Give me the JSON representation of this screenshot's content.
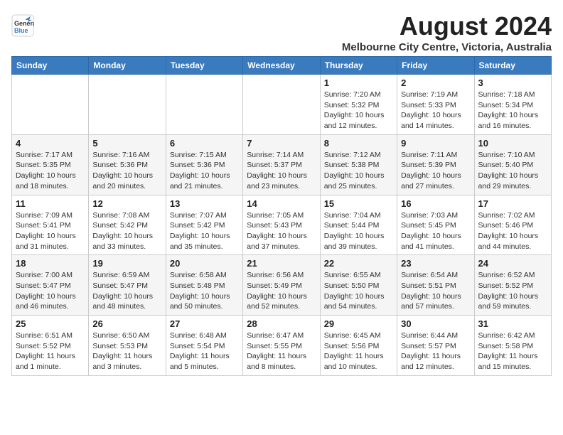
{
  "logo": {
    "general": "General",
    "blue": "Blue"
  },
  "title": "August 2024",
  "subtitle": "Melbourne City Centre, Victoria, Australia",
  "days_of_week": [
    "Sunday",
    "Monday",
    "Tuesday",
    "Wednesday",
    "Thursday",
    "Friday",
    "Saturday"
  ],
  "weeks": [
    [
      {
        "day": "",
        "info": ""
      },
      {
        "day": "",
        "info": ""
      },
      {
        "day": "",
        "info": ""
      },
      {
        "day": "",
        "info": ""
      },
      {
        "day": "1",
        "info": "Sunrise: 7:20 AM\nSunset: 5:32 PM\nDaylight: 10 hours\nand 12 minutes."
      },
      {
        "day": "2",
        "info": "Sunrise: 7:19 AM\nSunset: 5:33 PM\nDaylight: 10 hours\nand 14 minutes."
      },
      {
        "day": "3",
        "info": "Sunrise: 7:18 AM\nSunset: 5:34 PM\nDaylight: 10 hours\nand 16 minutes."
      }
    ],
    [
      {
        "day": "4",
        "info": "Sunrise: 7:17 AM\nSunset: 5:35 PM\nDaylight: 10 hours\nand 18 minutes."
      },
      {
        "day": "5",
        "info": "Sunrise: 7:16 AM\nSunset: 5:36 PM\nDaylight: 10 hours\nand 20 minutes."
      },
      {
        "day": "6",
        "info": "Sunrise: 7:15 AM\nSunset: 5:36 PM\nDaylight: 10 hours\nand 21 minutes."
      },
      {
        "day": "7",
        "info": "Sunrise: 7:14 AM\nSunset: 5:37 PM\nDaylight: 10 hours\nand 23 minutes."
      },
      {
        "day": "8",
        "info": "Sunrise: 7:12 AM\nSunset: 5:38 PM\nDaylight: 10 hours\nand 25 minutes."
      },
      {
        "day": "9",
        "info": "Sunrise: 7:11 AM\nSunset: 5:39 PM\nDaylight: 10 hours\nand 27 minutes."
      },
      {
        "day": "10",
        "info": "Sunrise: 7:10 AM\nSunset: 5:40 PM\nDaylight: 10 hours\nand 29 minutes."
      }
    ],
    [
      {
        "day": "11",
        "info": "Sunrise: 7:09 AM\nSunset: 5:41 PM\nDaylight: 10 hours\nand 31 minutes."
      },
      {
        "day": "12",
        "info": "Sunrise: 7:08 AM\nSunset: 5:42 PM\nDaylight: 10 hours\nand 33 minutes."
      },
      {
        "day": "13",
        "info": "Sunrise: 7:07 AM\nSunset: 5:42 PM\nDaylight: 10 hours\nand 35 minutes."
      },
      {
        "day": "14",
        "info": "Sunrise: 7:05 AM\nSunset: 5:43 PM\nDaylight: 10 hours\nand 37 minutes."
      },
      {
        "day": "15",
        "info": "Sunrise: 7:04 AM\nSunset: 5:44 PM\nDaylight: 10 hours\nand 39 minutes."
      },
      {
        "day": "16",
        "info": "Sunrise: 7:03 AM\nSunset: 5:45 PM\nDaylight: 10 hours\nand 41 minutes."
      },
      {
        "day": "17",
        "info": "Sunrise: 7:02 AM\nSunset: 5:46 PM\nDaylight: 10 hours\nand 44 minutes."
      }
    ],
    [
      {
        "day": "18",
        "info": "Sunrise: 7:00 AM\nSunset: 5:47 PM\nDaylight: 10 hours\nand 46 minutes."
      },
      {
        "day": "19",
        "info": "Sunrise: 6:59 AM\nSunset: 5:47 PM\nDaylight: 10 hours\nand 48 minutes."
      },
      {
        "day": "20",
        "info": "Sunrise: 6:58 AM\nSunset: 5:48 PM\nDaylight: 10 hours\nand 50 minutes."
      },
      {
        "day": "21",
        "info": "Sunrise: 6:56 AM\nSunset: 5:49 PM\nDaylight: 10 hours\nand 52 minutes."
      },
      {
        "day": "22",
        "info": "Sunrise: 6:55 AM\nSunset: 5:50 PM\nDaylight: 10 hours\nand 54 minutes."
      },
      {
        "day": "23",
        "info": "Sunrise: 6:54 AM\nSunset: 5:51 PM\nDaylight: 10 hours\nand 57 minutes."
      },
      {
        "day": "24",
        "info": "Sunrise: 6:52 AM\nSunset: 5:52 PM\nDaylight: 10 hours\nand 59 minutes."
      }
    ],
    [
      {
        "day": "25",
        "info": "Sunrise: 6:51 AM\nSunset: 5:52 PM\nDaylight: 11 hours\nand 1 minute."
      },
      {
        "day": "26",
        "info": "Sunrise: 6:50 AM\nSunset: 5:53 PM\nDaylight: 11 hours\nand 3 minutes."
      },
      {
        "day": "27",
        "info": "Sunrise: 6:48 AM\nSunset: 5:54 PM\nDaylight: 11 hours\nand 5 minutes."
      },
      {
        "day": "28",
        "info": "Sunrise: 6:47 AM\nSunset: 5:55 PM\nDaylight: 11 hours\nand 8 minutes."
      },
      {
        "day": "29",
        "info": "Sunrise: 6:45 AM\nSunset: 5:56 PM\nDaylight: 11 hours\nand 10 minutes."
      },
      {
        "day": "30",
        "info": "Sunrise: 6:44 AM\nSunset: 5:57 PM\nDaylight: 11 hours\nand 12 minutes."
      },
      {
        "day": "31",
        "info": "Sunrise: 6:42 AM\nSunset: 5:58 PM\nDaylight: 11 hours\nand 15 minutes."
      }
    ]
  ]
}
